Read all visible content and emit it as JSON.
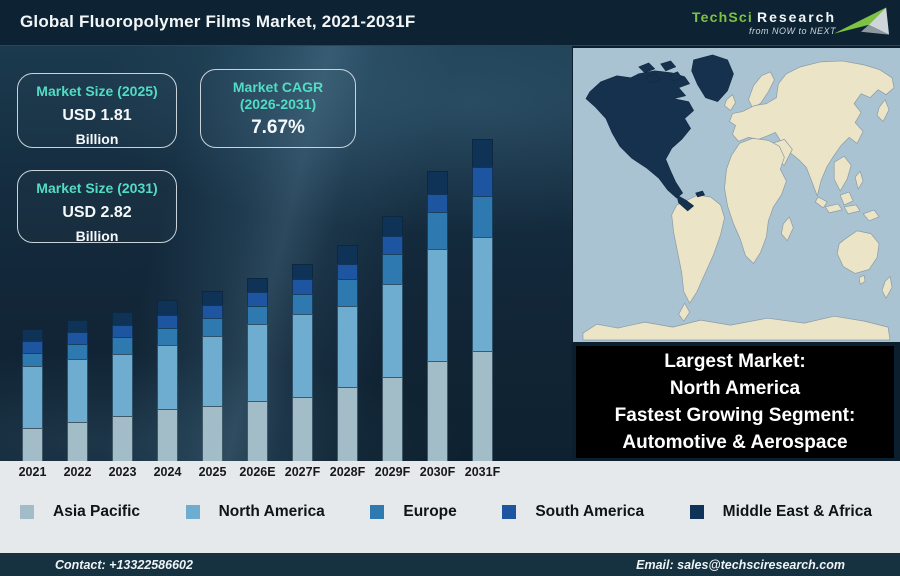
{
  "header": {
    "title": "Global Fluoropolymer Films Market, 2021-2031F",
    "logo": {
      "brand": "TechSci",
      "brand2": "Research",
      "tagline": "from NOW to NEXT"
    }
  },
  "stat_boxes": [
    {
      "label": "Market Size (2025)",
      "value": "USD 1.81",
      "unit": "Billion"
    },
    {
      "label": "Market CAGR (2026-2031)",
      "value": "7.67%"
    },
    {
      "label": "Market Size (2031)",
      "value": "USD 2.82",
      "unit": "Billion"
    }
  ],
  "chart_data": {
    "type": "bar",
    "stacked": true,
    "title": "Global Fluoropolymer Films Market, 2021-2031F",
    "unit": "USD Billion",
    "y_axis": "hidden (no scale shown)",
    "legend_position": "bottom",
    "categories": [
      "2021",
      "2022",
      "2023",
      "2024",
      "2025",
      "2026E",
      "2027F",
      "2028F",
      "2029F",
      "2030F",
      "2031F"
    ],
    "series": [
      {
        "name": "Asia Pacific",
        "color": "#a2bcc8",
        "values": [
          33,
          39,
          45,
          52,
          55,
          60,
          64,
          74,
          84,
          100,
          110
        ]
      },
      {
        "name": "North America",
        "color": "#6fadd0",
        "values": [
          62,
          63,
          62,
          64,
          70,
          77,
          83,
          81,
          93,
          112,
          114
        ]
      },
      {
        "name": "Europe",
        "color": "#2e7ab0",
        "values": [
          13,
          15,
          17,
          17,
          18,
          18,
          20,
          27,
          30,
          37,
          41
        ]
      },
      {
        "name": "South America",
        "color": "#1d55a0",
        "values": [
          12,
          12,
          12,
          13,
          13,
          14,
          15,
          15,
          18,
          18,
          29
        ]
      },
      {
        "name": "Middle East & Africa",
        "color": "#0e3356",
        "values": [
          12,
          12,
          13,
          15,
          14,
          14,
          15,
          19,
          20,
          23,
          28
        ]
      }
    ],
    "value_note": "segment heights in relative units read off the stylized chart; labeled totals: 2025 = USD 1.81 Billion, 2031 = USD 2.82 Billion, CAGR 2026-2031 = 7.67%"
  },
  "callout": {
    "lines": [
      "Largest Market:",
      "North America",
      "Fastest Growing Segment:",
      "Automotive & Aerospace"
    ]
  },
  "map": {
    "highlighted_region": "North America"
  },
  "footer": {
    "contact": "Contact: +13322586602",
    "email": "Email: sales@techsciresearch.com"
  },
  "colors": {
    "accent_teal": "#52dcc4",
    "header_bg": "#0d2333",
    "chart_bg": "#142c3e",
    "band_bg": "#e5e9ec",
    "footer_bg": "#16313f",
    "callout_bg": "#000000",
    "logo_green": "#7dc242",
    "map_ocean": "#a9c3d2",
    "map_land": "#ece4c6",
    "map_highlight": "#16314e"
  }
}
